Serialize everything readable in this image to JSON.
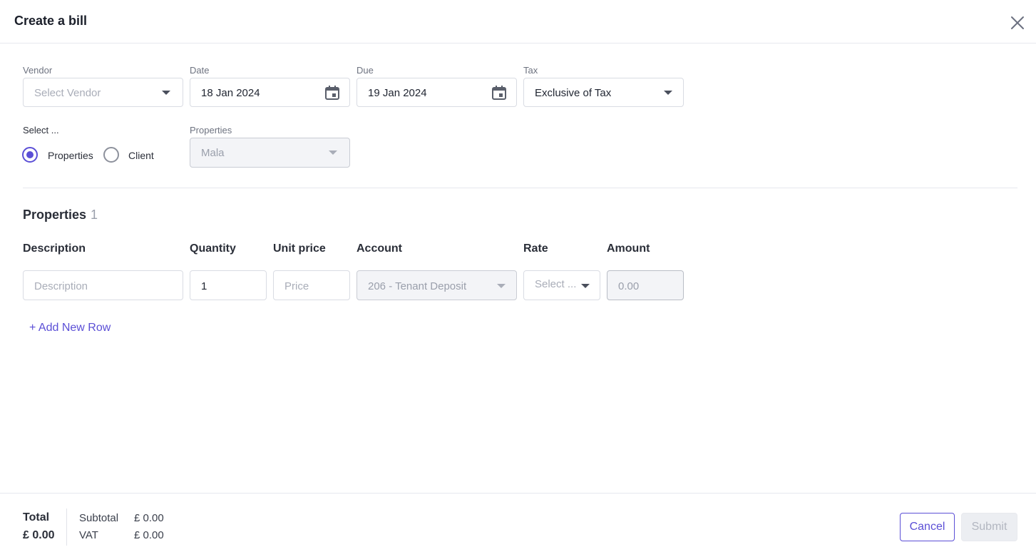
{
  "header": {
    "title": "Create a bill",
    "close_icon": "close-icon"
  },
  "form": {
    "vendor": {
      "label": "Vendor",
      "placeholder": "Select Vendor"
    },
    "date": {
      "label": "Date",
      "value": "18 Jan 2024"
    },
    "due": {
      "label": "Due",
      "value": "19 Jan 2024"
    },
    "tax": {
      "label": "Tax",
      "value": "Exclusive of Tax"
    },
    "select_type": {
      "label": "Select ...",
      "options": [
        {
          "label": "Properties",
          "checked": true
        },
        {
          "label": "Client",
          "checked": false
        }
      ]
    },
    "properties_select": {
      "label": "Properties",
      "value": "Mala"
    }
  },
  "section": {
    "title": "Properties",
    "count": "1",
    "columns": [
      "Description",
      "Quantity",
      "Unit price",
      "Account",
      "Rate",
      "Amount"
    ],
    "rows": [
      {
        "description_placeholder": "Description",
        "quantity": "1",
        "price_placeholder": "Price",
        "account": "206 - Tenant Deposit",
        "rate_placeholder": "Select ...",
        "amount": "0.00"
      }
    ],
    "add_row_label": "+ Add New Row"
  },
  "footer": {
    "total_label": "Total",
    "total_value": "£ 0.00",
    "subtotal_label": "Subtotal",
    "subtotal_value": "£ 0.00",
    "vat_label": "VAT",
    "vat_value": "£ 0.00",
    "cancel_label": "Cancel",
    "submit_label": "Submit"
  },
  "colors": {
    "accent": "#5b4fd6",
    "border": "#d9dce3",
    "muted": "#a9adb8"
  }
}
